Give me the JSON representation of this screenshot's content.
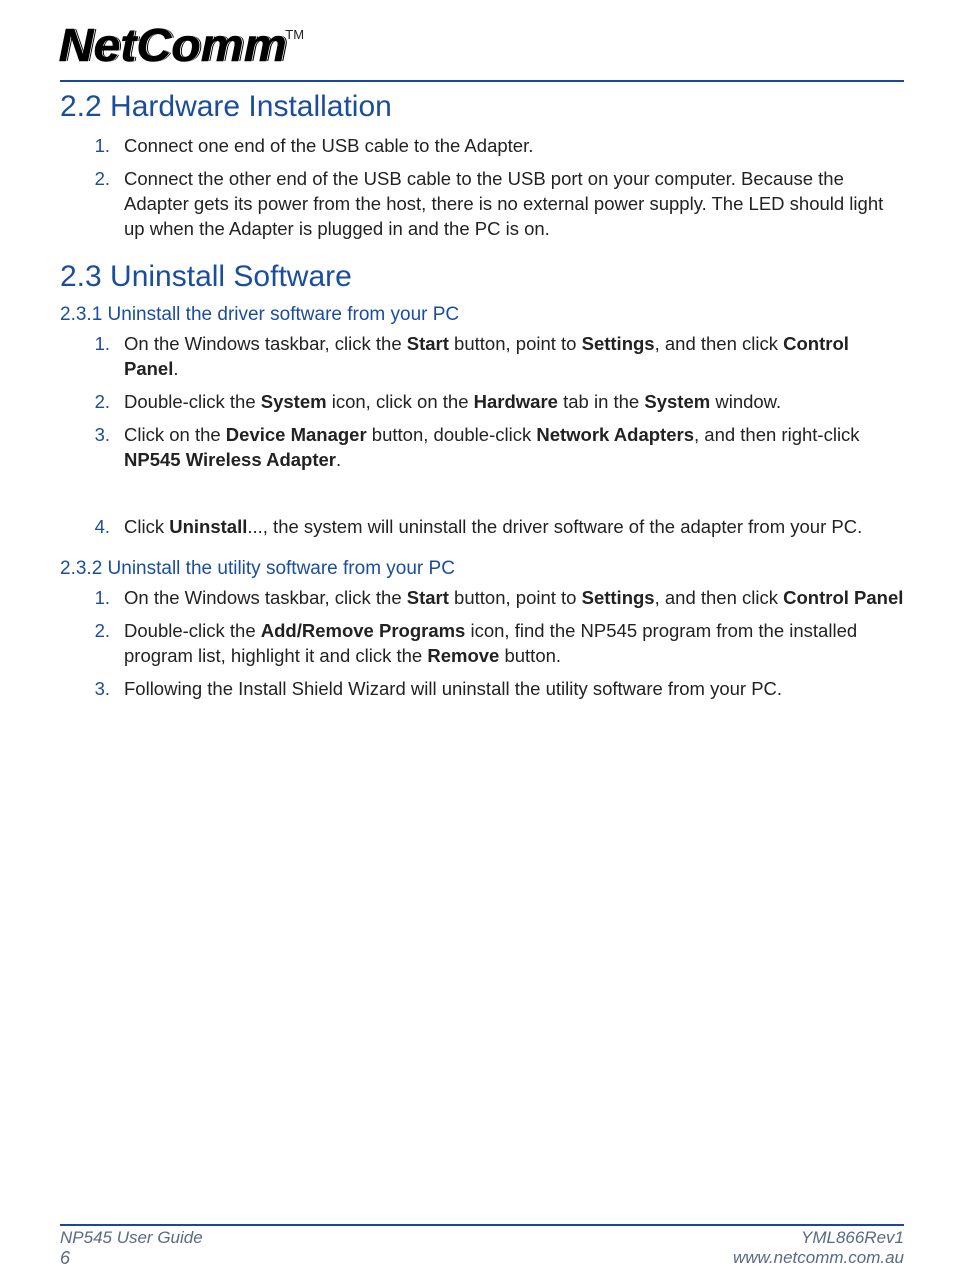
{
  "logo": {
    "brand": "NetComm",
    "trademark": "TM"
  },
  "sections": {
    "hw": {
      "title": "2.2 Hardware Installation",
      "steps": [
        "Connect one end of the USB cable to the Adapter.",
        "Connect the other end of the USB cable to the USB port on your computer. Because the Adapter gets its power from the host, there is no external power supply. The LED should light up when the Adapter is plugged in and the PC is on."
      ]
    },
    "uninstall": {
      "title": "2.3 Uninstall Software",
      "sub1": {
        "title": "2.3.1 Uninstall the driver software from your PC",
        "steps_html": [
          "On the Windows taskbar, click the <b>Start</b> button, point to <b>Settings</b>, and then click <b>Control Panel</b>.",
          "Double-click the <b>System</b> icon, click on the <b>Hardware</b> tab in the <b>System</b> window.",
          "Click on the <b>Device Manager</b> button, double-click <b>Network Adapters</b>, and then right-click <b>NP545 Wireless Adapter</b>.",
          "Click <b>Uninstall</b>..., the system will uninstall the driver software of the adapter from your PC."
        ]
      },
      "sub2": {
        "title": "2.3.2 Uninstall the utility software from your PC",
        "steps_html": [
          "On the Windows taskbar, click the <b>Start</b> button, point to <b>Settings</b>, and then click <b>Control Panel</b>",
          "Double-click the <b>Add/Remove Programs</b> icon, find the NP545 program from the installed program list, highlight it and click the <b>Remove</b> button.",
          "Following the Install Shield Wizard will uninstall the utility software from your PC."
        ]
      }
    }
  },
  "footer": {
    "guide": "NP545 User Guide",
    "page": "6",
    "doc_ref": "YML866Rev1",
    "url": "www.netcomm.com.au"
  }
}
